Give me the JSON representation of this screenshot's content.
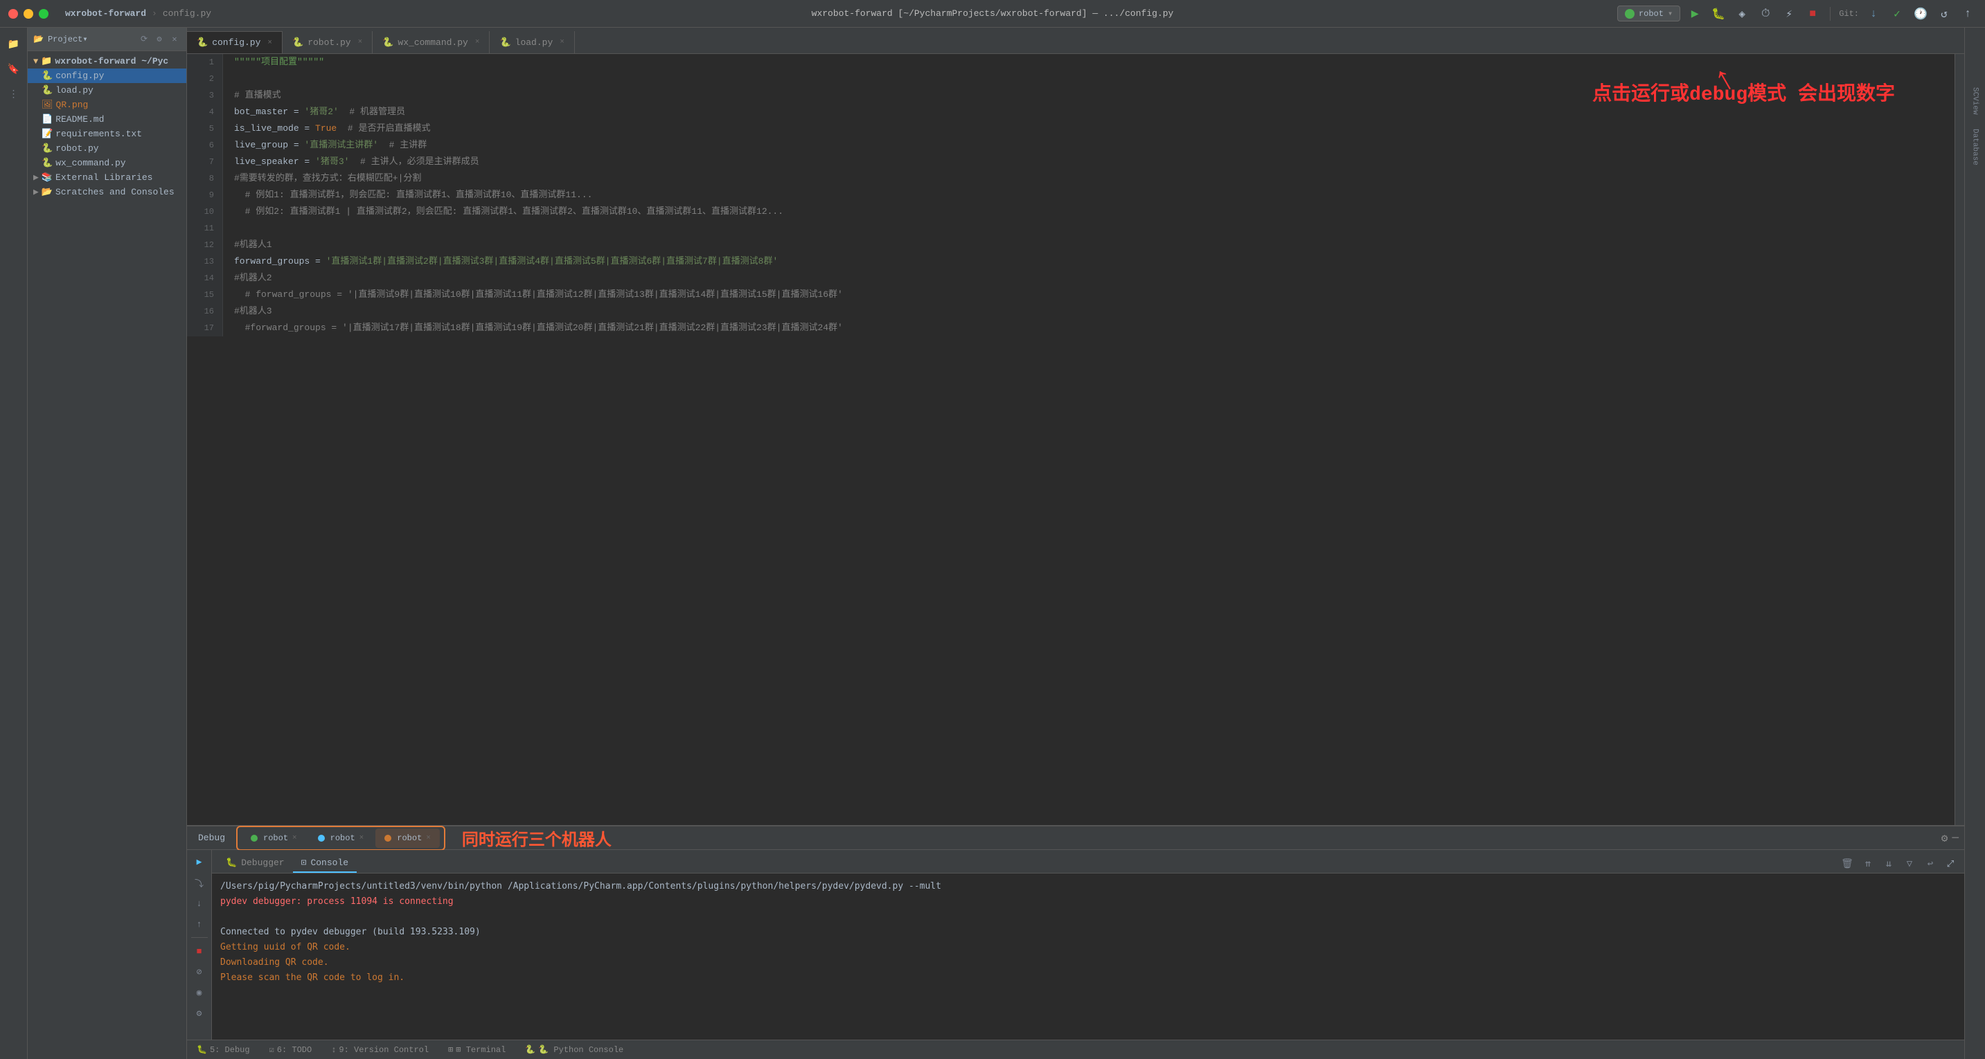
{
  "titlebar": {
    "title": "wxrobot-forward [~/PycharmProjects/wxrobot-forward] — .../config.py",
    "project_name": "wxrobot-forward",
    "active_file": "config.py"
  },
  "tabs": [
    {
      "id": "config",
      "label": "config.py",
      "active": true,
      "icon": "🐍"
    },
    {
      "id": "robot",
      "label": "robot.py",
      "active": false,
      "icon": "🐍"
    },
    {
      "id": "wx_command",
      "label": "wx_command.py",
      "active": false,
      "icon": "🐍"
    },
    {
      "id": "load",
      "label": "load.py",
      "active": false,
      "icon": "🐍"
    }
  ],
  "project_tree": {
    "root": "wxrobot-forward ~/Pyc",
    "items": [
      {
        "name": "config.py",
        "type": "py",
        "indent": 1
      },
      {
        "name": "load.py",
        "type": "py",
        "indent": 1
      },
      {
        "name": "QR.png",
        "type": "png",
        "indent": 1
      },
      {
        "name": "README.md",
        "type": "md",
        "indent": 1
      },
      {
        "name": "requirements.txt",
        "type": "txt",
        "indent": 1
      },
      {
        "name": "robot.py",
        "type": "py",
        "indent": 1
      },
      {
        "name": "wx_command.py",
        "type": "py",
        "indent": 1
      },
      {
        "name": "External Libraries",
        "type": "folder",
        "indent": 0
      },
      {
        "name": "Scratches and Consoles",
        "type": "folder",
        "indent": 0
      }
    ]
  },
  "toolbar": {
    "run_config": "robot",
    "run_label": "▶",
    "debug_label": "🐛",
    "git_label": "Git:"
  },
  "code_lines": [
    {
      "num": 1,
      "content": "\"\"\"项目配置\"\"\""
    },
    {
      "num": 2,
      "content": ""
    },
    {
      "num": 3,
      "content": "# 直播模式"
    },
    {
      "num": 4,
      "content": "bot_master = '猪哥2'  # 机器管理员"
    },
    {
      "num": 5,
      "content": "is_live_mode = True  # 是否开启直播模式"
    },
    {
      "num": 6,
      "content": "live_group = '直播测试主讲群'  # 主讲群"
    },
    {
      "num": 7,
      "content": "live_speaker = '猪哥3'  # 主讲人，必须是主讲群成员"
    },
    {
      "num": 8,
      "content": "#需要转发的群，查找方式：右模糊匹配+|分割"
    },
    {
      "num": 9,
      "content": "  # 例如1: 直播测试群1，则会匹配: 直播测试群1、直播测试群10、直播测试群11..."
    },
    {
      "num": 10,
      "content": "  # 例如2: 直播测试群1 | 直播测试群2，则会匹配: 直播测试群1、直播测试群2、直播测试群10、直播测试群11、直播测试群12..."
    },
    {
      "num": 11,
      "content": ""
    },
    {
      "num": 12,
      "content": "#机器人1"
    },
    {
      "num": 13,
      "content": "forward_groups = '直播测试1群|直播测试2群|直播测试3群|直播测试4群|直播测试5群|直播测试6群|直播测试7群|直播测试8群'"
    },
    {
      "num": 14,
      "content": "#机器人2"
    },
    {
      "num": 15,
      "content": "  # forward_groups = '|直播测试9群|直播测试10群|直播测试11群|直播测试12群|直播测试13群|直播测试14群|直播测试15群|直播测试16群'"
    },
    {
      "num": 16,
      "content": "#机器人3"
    },
    {
      "num": 17,
      "content": "  #forward_groups = '|直播测试17群|直播测试18群|直播测试19群|直播测试20群|直播测试21群|直播测试22群|直播测试23群|直播测试24群'"
    }
  ],
  "annotation": {
    "text": "点击运行或debug模式\n会出现数字",
    "arrow_text": "↗"
  },
  "debug_panel": {
    "label": "Debug",
    "tabs": [
      {
        "id": "robot1",
        "label": "robot",
        "active": false,
        "color": "green"
      },
      {
        "id": "robot2",
        "label": "robot",
        "active": false,
        "color": "blue"
      },
      {
        "id": "robot3",
        "label": "robot",
        "active": true,
        "color": "orange"
      }
    ],
    "annotation": "同时运行三个机器人",
    "subtabs": [
      {
        "id": "debugger",
        "label": "Debugger",
        "active": false
      },
      {
        "id": "console",
        "label": "Console",
        "active": true
      }
    ],
    "output": [
      {
        "type": "white",
        "text": "/Users/pig/PycharmProjects/untitled3/venv/bin/python /Applications/PyCharm.app/Contents/plugins/python/helpers/pydev/pydevd.py --mult"
      },
      {
        "type": "red",
        "text": "pydev debugger: process 11094 is connecting"
      },
      {
        "type": "white",
        "text": ""
      },
      {
        "type": "white",
        "text": "Connected to pydev debugger (build 193.5233.109)"
      },
      {
        "type": "orange",
        "text": "Getting uuid of QR code."
      },
      {
        "type": "orange",
        "text": "Downloading QR code."
      },
      {
        "type": "orange",
        "text": "Please scan the QR code to log in."
      }
    ]
  },
  "status_bar": {
    "debug_label": "🐛 5: Debug",
    "todo_label": "☑ 6: TODO",
    "version_label": "↕ 9: Version Control",
    "terminal_label": "⊞ Terminal",
    "python_console": "🐍 Python Console"
  },
  "colors": {
    "accent": "#4fc1ff",
    "green": "#4caf50",
    "orange": "#cc7832",
    "red": "#ff3333",
    "bg_dark": "#2b2b2b",
    "bg_panel": "#3c3f41",
    "tab_active_border": "#e07b39"
  }
}
